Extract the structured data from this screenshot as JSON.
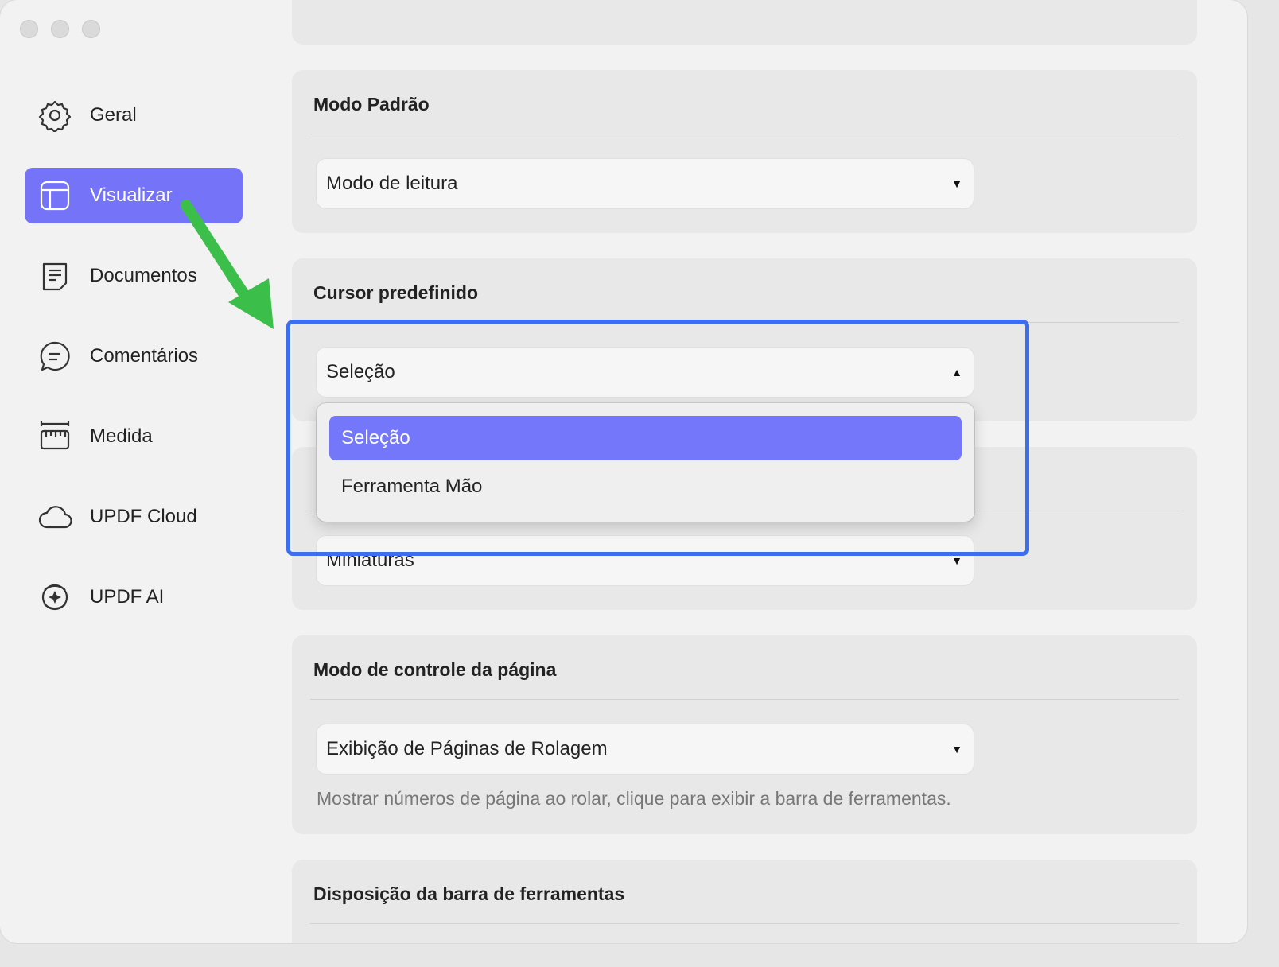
{
  "window": {
    "controls": [
      "close",
      "minimize",
      "zoom"
    ]
  },
  "sidebar": {
    "items": [
      {
        "label": "Geral",
        "icon": "gear-icon",
        "active": false
      },
      {
        "label": "Visualizar",
        "icon": "layout-icon",
        "active": true
      },
      {
        "label": "Documentos",
        "icon": "document-icon",
        "active": false
      },
      {
        "label": "Comentários",
        "icon": "comment-icon",
        "active": false
      },
      {
        "label": "Medida",
        "icon": "ruler-icon",
        "active": false
      },
      {
        "label": "UPDF Cloud",
        "icon": "cloud-icon",
        "active": false
      },
      {
        "label": "UPDF AI",
        "icon": "ai-icon",
        "active": false
      }
    ],
    "accent": "#7573f7"
  },
  "sections": {
    "default_mode": {
      "title": "Modo Padrão",
      "value": "Modo de leitura"
    },
    "default_cursor": {
      "title": "Cursor predefinido",
      "value": "Seleção",
      "options": [
        {
          "label": "Seleção",
          "selected": true
        },
        {
          "label": "Ferramenta Mão",
          "selected": false
        }
      ]
    },
    "sidebar_mode": {
      "value": "Miniaturas"
    },
    "page_control": {
      "title": "Modo de controle da página",
      "value": "Exibição de Páginas de Rolagem",
      "hint": "Mostrar números de página ao rolar, clique para exibir a barra de ferramentas."
    },
    "toolbar_layout": {
      "title": "Disposição da barra de ferramentas"
    }
  },
  "annotation": {
    "highlight_color": "#3c6ff0",
    "arrow_color": "#3cbf4a"
  }
}
